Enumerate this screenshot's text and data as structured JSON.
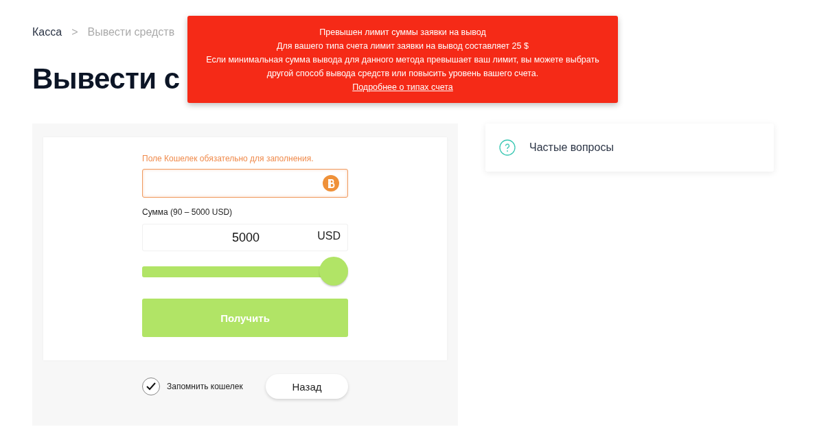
{
  "breadcrumb": {
    "items": [
      "Касса",
      "Вывести средств"
    ],
    "separator": ">"
  },
  "title": "Вывести с",
  "form": {
    "wallet_error": "Поле Кошелек обязательно для заполнения.",
    "wallet_invalid": true,
    "amount_label": "Сумма (90 – 5000 USD)",
    "amount": "5000",
    "currency": "USD",
    "slider": {
      "level": 1
    },
    "submit": "Получить",
    "remember": {
      "label": "Запомнить кошелек",
      "checked": true
    },
    "back": "Назад"
  },
  "faq": {
    "label": "Частые вопросы"
  },
  "toast": {
    "lines": [
      "Превышен лимит суммы заявки на вывод",
      "Для вашего типа счета лимит заявки на вывод составляет 25 $",
      "Если минимальная сумма вывода для данного метода превышает ваш лимит, вы можете выбрать другой способ вывода средств или повысить уровень вашего счета."
    ],
    "link": "Подробнее о типах счета"
  }
}
